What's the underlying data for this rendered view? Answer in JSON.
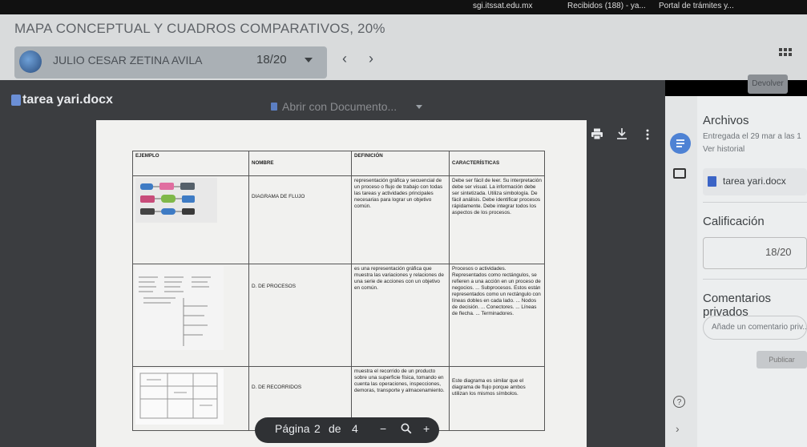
{
  "browser": {
    "bookmarks": [
      "sgi.itssat.edu.mx",
      "Recibidos (188) - ya...",
      "Portal de trámites y..."
    ]
  },
  "assignment": {
    "title": "MAPA CONCEPTUAL Y CUADROS COMPARATIVOS, 20%"
  },
  "student": {
    "name": "JULIO CESAR ZETINA AVILA",
    "counter": "18/20"
  },
  "header": {
    "devolver_label": "Devolver"
  },
  "viewer": {
    "file_name": "tarea yari.docx",
    "open_with_label": "Abrir con Documento...",
    "page_label": "Página",
    "page_current": "2",
    "page_of": "de",
    "page_total": "4"
  },
  "document": {
    "headers": [
      "EJEMPLO",
      "NOMBRE",
      "DEFINICIÓN",
      "CARACTERÍSTICAS"
    ],
    "rows": [
      {
        "nombre": "DIAGRAMA DE FLUJO",
        "definicion": "representación gráfica y secuencial de un proceso o flujo de trabajo con todas las tareas y actividades principales necesarias para lograr un objetivo común.",
        "caracteristicas": "Debe ser fácil de leer. Su interpretación debe ser visual. La información debe ser sintetizada. Utiliza simbología. De fácil análisis. Debe identificar procesos rápidamente. Debe integrar todos los aspectos de los procesos."
      },
      {
        "nombre": "D. DE PROCESOS",
        "definicion": "es una representación gráfica que muestra las variaciones y relaciones de una serie de acciones con un objetivo en común.",
        "caracteristicas": "Procesos o actividades. Representados como rectángulos, se refieren a una acción en un proceso de negocios. ... Subprocesos. Estos están representados como un rectángulo con líneas dobles en cada lado. ... Nodos de decisión. ... Conectores. ... Líneas de flecha. ... Terminadores."
      },
      {
        "nombre": "D. DE RECORRIDOS",
        "definicion": "muestra el recorrido de un producto sobre una superficie física, tomando en cuenta las operaciones, inspecciones, demoras, transporte y almacenamiento.",
        "caracteristicas": "Este diagrama es similar que el diagrama de flujo porque ambos utilizan los mismos símbolos."
      }
    ]
  },
  "panel": {
    "archivos_title": "Archivos",
    "submitted_text": "Entregada el 29 mar a las 1",
    "history_link": "Ver historial",
    "attached_file": "tarea yari.docx",
    "grade_title": "Calificación",
    "grade_value": "18/20",
    "comments_title": "Comentarios privados",
    "comment_placeholder": "Añade un comentario priv...",
    "publish_label": "Publicar"
  }
}
